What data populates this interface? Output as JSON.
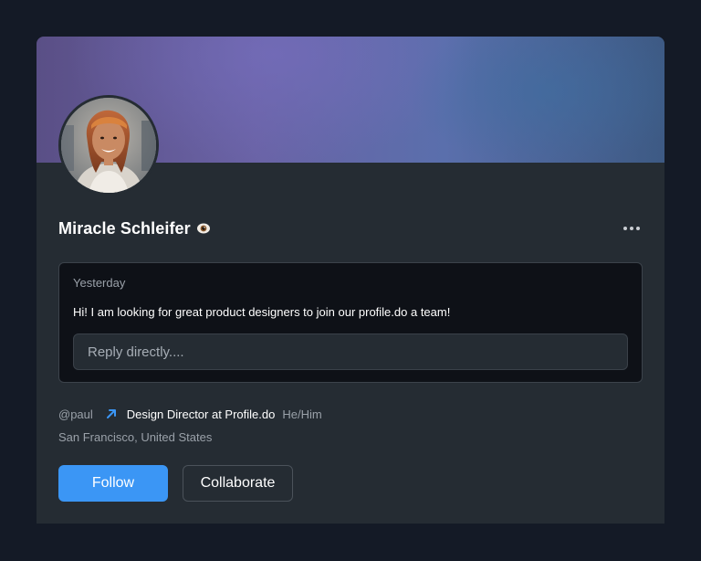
{
  "profile": {
    "name": "Miracle Schleifer",
    "name_emoji_icon": "eye-icon",
    "more_icon": "more-horizontal-icon",
    "handle": "@paul",
    "link_icon": "arrow-up-right-icon",
    "role": "Design Director at Profile.do",
    "pronouns": "He/Him",
    "location": "San Francisco, United States"
  },
  "message": {
    "time": "Yesterday",
    "text": "Hi! I am looking for great product designers to join our profile.do a team!",
    "reply_placeholder": "Reply directly....",
    "reply_value": ""
  },
  "actions": {
    "follow_label": "Follow",
    "collaborate_label": "Collaborate"
  },
  "colors": {
    "page_bg": "#141a26",
    "card_bg": "#252c33",
    "accent": "#3b96f5",
    "message_bg": "#0e1117",
    "muted_text": "#9aa1a9"
  }
}
